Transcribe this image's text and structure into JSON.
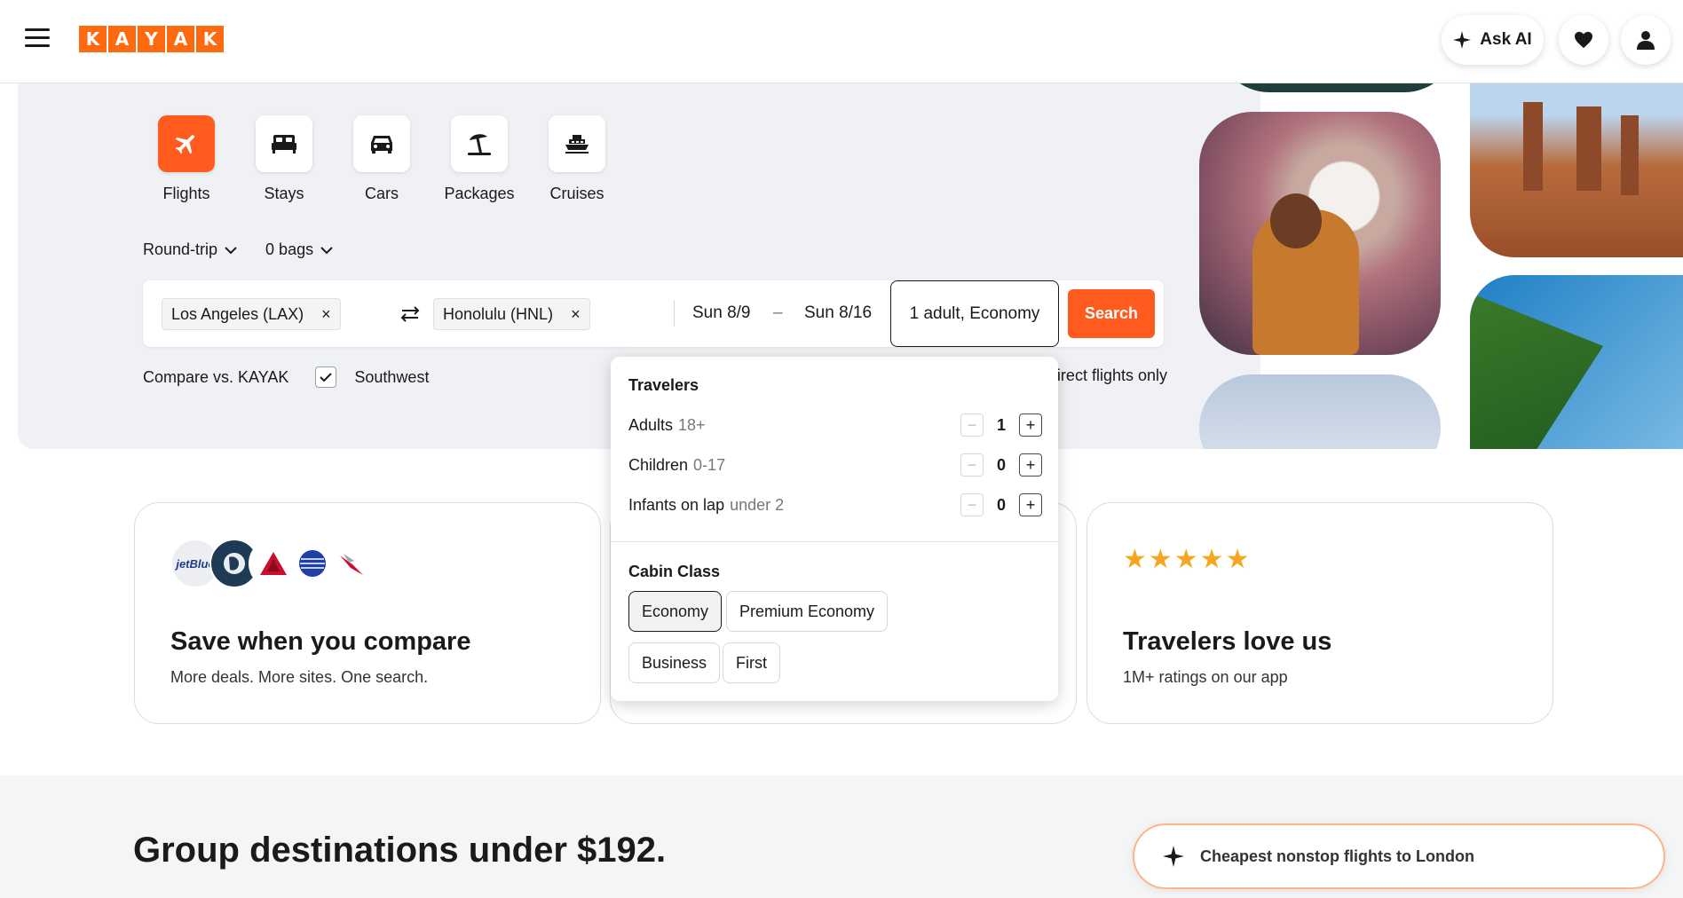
{
  "header": {
    "logo_letters": [
      "K",
      "A",
      "Y",
      "A",
      "K"
    ],
    "ask_ai_label": "Ask AI"
  },
  "verticals": [
    {
      "label": "Flights",
      "icon": "plane-icon",
      "active": true
    },
    {
      "label": "Stays",
      "icon": "bed-icon",
      "active": false
    },
    {
      "label": "Cars",
      "icon": "car-icon",
      "active": false
    },
    {
      "label": "Packages",
      "icon": "beach-umbrella-icon",
      "active": false
    },
    {
      "label": "Cruises",
      "icon": "ship-icon",
      "active": false
    }
  ],
  "search_options": {
    "trip_type": "Round-trip",
    "bags": "0 bags"
  },
  "search": {
    "origin": "Los Angeles (LAX)",
    "destination": "Honolulu (HNL)",
    "depart_date": "Sun 8/9",
    "date_separator": "–",
    "return_date": "Sun 8/16",
    "travelers": "1 adult, Economy",
    "search_label": "Search"
  },
  "compare": {
    "label": "Compare vs. KAYAK",
    "provider": "Southwest",
    "checked": true,
    "direct_label": "Direct flights only"
  },
  "travelers_dropdown": {
    "title": "Travelers",
    "rows": [
      {
        "label": "Adults",
        "sub": "18+",
        "count": "1"
      },
      {
        "label": "Children",
        "sub": "0-17",
        "count": "0"
      },
      {
        "label": "Infants on lap",
        "sub": "under 2",
        "count": "0"
      }
    ],
    "cabin_title": "Cabin Class",
    "cabins": [
      "Economy",
      "Premium Economy",
      "Business",
      "First"
    ],
    "selected_cabin": "Economy"
  },
  "cards": {
    "compare": {
      "title": "Save when you compare",
      "subtitle": "More deals. More sites. One search.",
      "airline_logos": [
        "jetBlue",
        "Alaska",
        "Delta",
        "United",
        "American"
      ]
    },
    "reviews": {
      "title": "Travelers love us",
      "subtitle": "1M+ ratings on our app",
      "stars": "★★★★★"
    }
  },
  "bottom": {
    "title": "Group destinations under $192.",
    "ai_prompt": "Cheapest nonstop flights to London"
  },
  "colors": {
    "accent": "#ff690f",
    "search_button": "#ff5b1f",
    "star": "#f5a623"
  }
}
